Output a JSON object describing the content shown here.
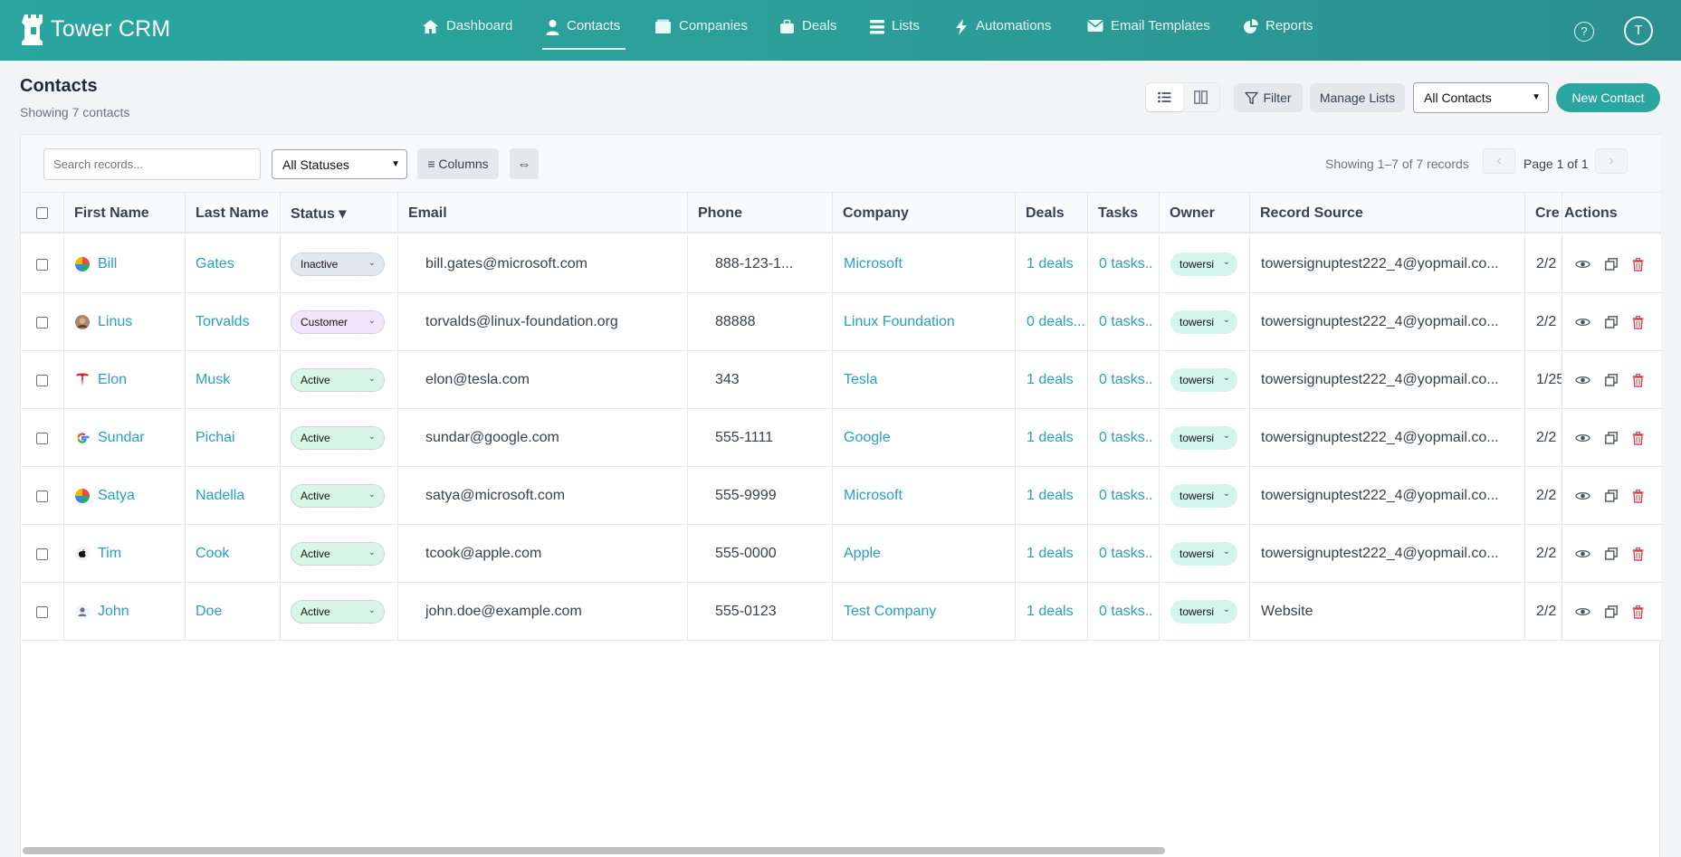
{
  "app": {
    "name": "Tower CRM",
    "brand_color": "#2aa59f"
  },
  "nav": {
    "items": [
      {
        "label": "Dashboard",
        "icon": "home-icon"
      },
      {
        "label": "Contacts",
        "icon": "person-icon",
        "active": true
      },
      {
        "label": "Companies",
        "icon": "building-icon"
      },
      {
        "label": "Deals",
        "icon": "briefcase-icon"
      },
      {
        "label": "Lists",
        "icon": "list-icon"
      },
      {
        "label": "Automations",
        "icon": "bolt-icon"
      },
      {
        "label": "Email Templates",
        "icon": "envelope-icon"
      },
      {
        "label": "Reports",
        "icon": "pie-chart-icon"
      }
    ],
    "help": "?",
    "avatar_initial": "T"
  },
  "header": {
    "title": "Contacts",
    "subtitle": "Showing 7 contacts",
    "filter_label": "Filter",
    "manage_lists_label": "Manage Lists",
    "list_select_value": "All Contacts",
    "new_contact_label": "New Contact"
  },
  "toolbar": {
    "search_placeholder": "Search records...",
    "status_filter_value": "All Statuses",
    "columns_label": "≡ Columns",
    "expand_label": "⇔",
    "records_info": "Showing 1–7 of 7 records",
    "page_info": "Page 1 of 1",
    "prev": "‹",
    "next": "›"
  },
  "table": {
    "headers": {
      "first_name": "First Name",
      "last_name": "Last Name",
      "status": "Status ▾",
      "email": "Email",
      "phone": "Phone",
      "company": "Company",
      "deals": "Deals",
      "tasks": "Tasks",
      "owner": "Owner",
      "record_source": "Record Source",
      "created": "Cre",
      "actions": "Actions"
    },
    "rows": [
      {
        "first": "Bill",
        "last": "Gates",
        "status": "Inactive",
        "email": "bill.gates@microsoft.com",
        "phone": "888-123-1...",
        "company": "Microsoft",
        "deals": "1 deals",
        "tasks": "0 tasks..",
        "owner": "towersi",
        "source": "towersignuptest222_4@yopmail.co...",
        "created": "2/2",
        "avatar": "microsoft-logo-icon"
      },
      {
        "first": "Linus",
        "last": "Torvalds",
        "status": "Customer",
        "email": "torvalds@linux-foundation.org",
        "phone": "88888",
        "company": "Linux Foundation",
        "deals": "0 deals...",
        "tasks": "0 tasks..",
        "owner": "towersi",
        "source": "towersignuptest222_4@yopmail.co...",
        "created": "2/2",
        "avatar": "linus-photo-icon"
      },
      {
        "first": "Elon",
        "last": "Musk",
        "status": "Active",
        "email": "elon@tesla.com",
        "phone": "343",
        "company": "Tesla",
        "deals": "1 deals",
        "tasks": "0 tasks..",
        "owner": "towersi",
        "source": "towersignuptest222_4@yopmail.co...",
        "created": "1/25",
        "avatar": "tesla-logo-icon"
      },
      {
        "first": "Sundar",
        "last": "Pichai",
        "status": "Active",
        "email": "sundar@google.com",
        "phone": "555-1111",
        "company": "Google",
        "deals": "1 deals",
        "tasks": "0 tasks..",
        "owner": "towersi",
        "source": "towersignuptest222_4@yopmail.co...",
        "created": "2/2",
        "avatar": "google-logo-icon"
      },
      {
        "first": "Satya",
        "last": "Nadella",
        "status": "Active",
        "email": "satya@microsoft.com",
        "phone": "555-9999",
        "company": "Microsoft",
        "deals": "1 deals",
        "tasks": "0 tasks..",
        "owner": "towersi",
        "source": "towersignuptest222_4@yopmail.co...",
        "created": "2/2",
        "avatar": "microsoft-logo-icon"
      },
      {
        "first": "Tim",
        "last": "Cook",
        "status": "Active",
        "email": "tcook@apple.com",
        "phone": "555-0000",
        "company": "Apple",
        "deals": "1 deals",
        "tasks": "0 tasks..",
        "owner": "towersi",
        "source": "towersignuptest222_4@yopmail.co...",
        "created": "2/2",
        "avatar": "apple-logo-icon"
      },
      {
        "first": "John",
        "last": "Doe",
        "status": "Active",
        "email": "john.doe@example.com",
        "phone": "555-0123",
        "company": "Test Company",
        "deals": "1 deals",
        "tasks": "0 tasks..",
        "owner": "towersi",
        "source": "Website",
        "created": "2/2",
        "avatar": "default-user-icon"
      }
    ]
  },
  "status_colors": {
    "Inactive": "#e2e8f0",
    "Customer": "#f1e6fb",
    "Active": "#d7f6e8"
  }
}
